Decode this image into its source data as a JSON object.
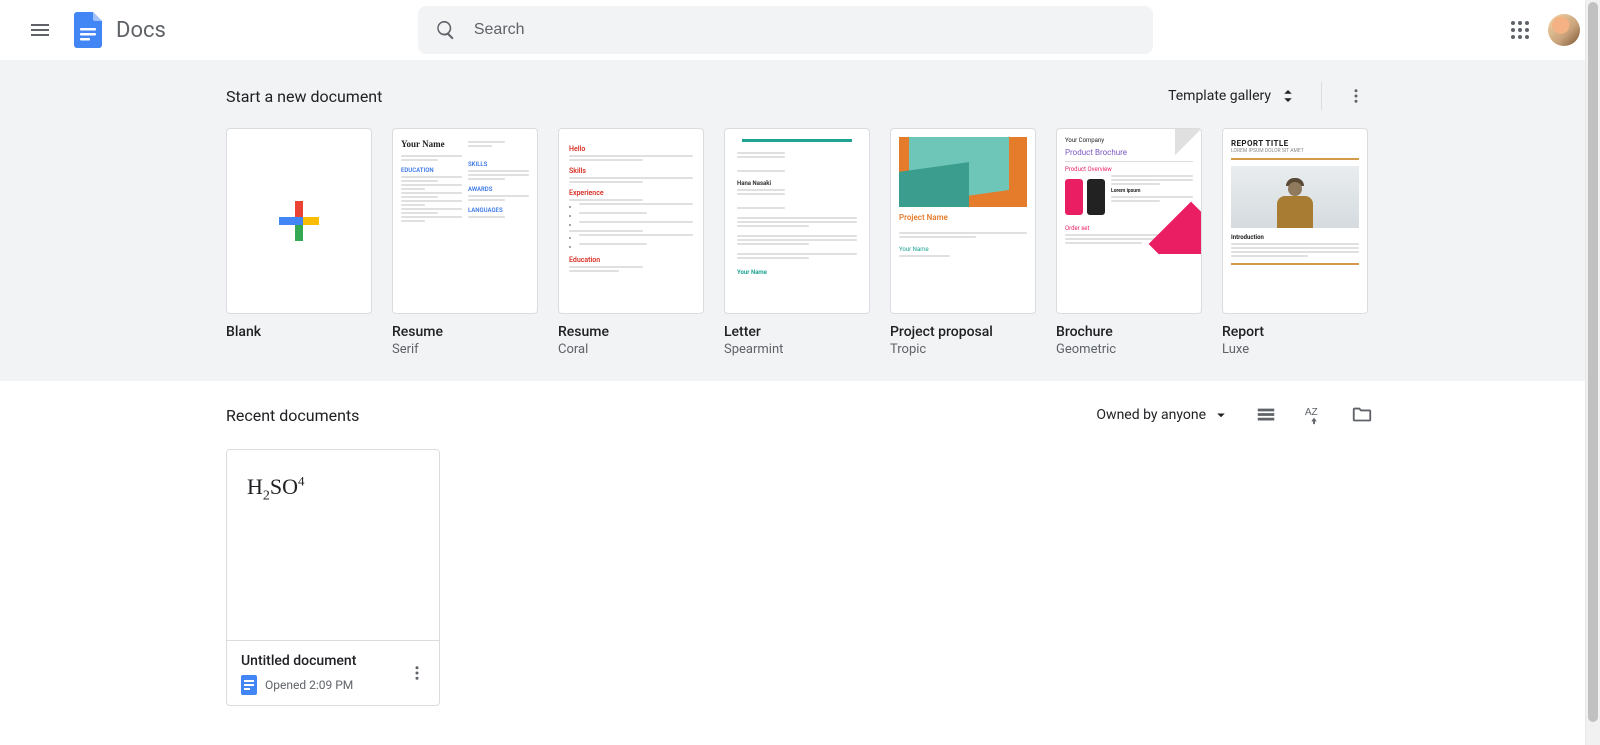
{
  "app": {
    "title": "Docs"
  },
  "search": {
    "placeholder": "Search"
  },
  "templates": {
    "heading": "Start a new document",
    "gallery_label": "Template gallery",
    "items": [
      {
        "title": "Blank",
        "sub": ""
      },
      {
        "title": "Resume",
        "sub": "Serif"
      },
      {
        "title": "Resume",
        "sub": "Coral"
      },
      {
        "title": "Letter",
        "sub": "Spearmint"
      },
      {
        "title": "Project proposal",
        "sub": "Tropic"
      },
      {
        "title": "Brochure",
        "sub": "Geometric"
      },
      {
        "title": "Report",
        "sub": "Luxe"
      }
    ]
  },
  "recent": {
    "heading": "Recent documents",
    "owned_label": "Owned by anyone",
    "docs": [
      {
        "name": "Untitled document",
        "meta": "Opened 2:09 PM",
        "preview_formula": {
          "prefix": "H",
          "sub": "2",
          "mid": "SO",
          "sup": "4"
        }
      }
    ]
  },
  "thumb_text": {
    "serif_name": "Your Name",
    "coral_hello": "Hello",
    "coral_skills": "Skills",
    "coral_experience": "Experience",
    "coral_education": "Education",
    "letter_signoff": "Your Name",
    "tropic_project": "Project Name",
    "geo_company": "Your Company",
    "geo_brochure": "Product Brochure",
    "geo_overview": "Product Overview",
    "geo_orderset": "Order set",
    "luxe_title": "REPORT TITLE",
    "luxe_sub": "LOREM IPSUM DOLOR SIT AMET",
    "luxe_intro": "Introduction"
  }
}
